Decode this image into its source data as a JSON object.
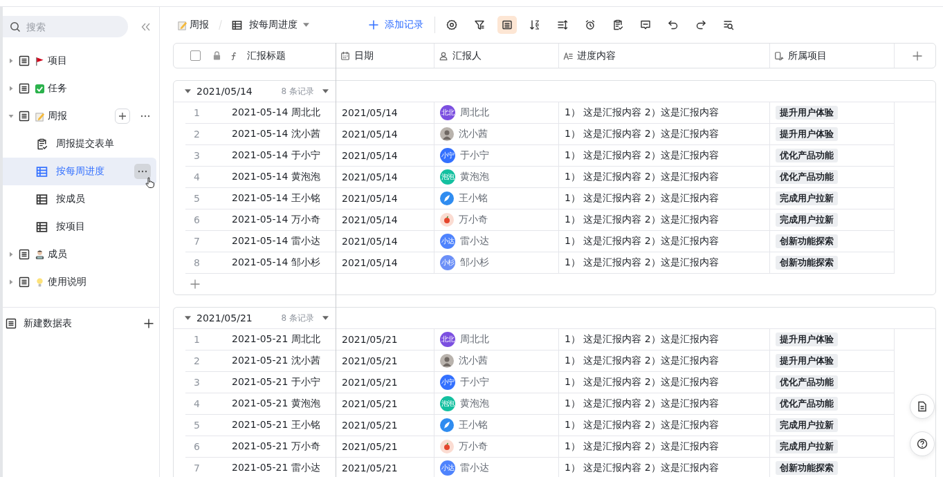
{
  "sidebar": {
    "search": {
      "placeholder": "搜索"
    },
    "items": [
      {
        "label": "项目",
        "expanded": false
      },
      {
        "label": "任务",
        "expanded": false
      },
      {
        "label": "周报",
        "expanded": true,
        "children": [
          {
            "label": "周报提交表单",
            "kind": "form",
            "selected": false
          },
          {
            "label": "按每周进度",
            "kind": "grid",
            "selected": true
          },
          {
            "label": "按成员",
            "kind": "grid",
            "selected": false
          },
          {
            "label": "按项目",
            "kind": "grid",
            "selected": false
          }
        ]
      },
      {
        "label": "成员",
        "expanded": false
      },
      {
        "label": "使用说明",
        "expanded": false
      }
    ],
    "new_table": "新建数据表"
  },
  "toolbar": {
    "breadcrumb": "周报",
    "view": "按每周进度",
    "add_record": "添加记录",
    "tools": [
      {
        "selected": false
      },
      {
        "selected": false
      },
      {
        "selected": true
      },
      {
        "selected": false
      },
      {
        "selected": false
      },
      {
        "selected": false
      },
      {
        "selected": false
      },
      {
        "selected": false
      },
      {
        "selected": false
      },
      {
        "selected": false
      },
      {
        "selected": false
      }
    ]
  },
  "table": {
    "select_all": {
      "checked": false
    },
    "columns": [
      "汇报标题",
      "日期",
      "汇报人",
      "进度内容",
      "所属项目"
    ],
    "groups": [
      {
        "title": "2021/05/14",
        "count": "8 条记录",
        "rows": [
          {
            "num": "1",
            "title": "2021-05-14 周北北",
            "date": "2021/05/14",
            "reporter": {
              "name": "周北北",
              "kind": "text",
              "avatar_text": "北北",
              "color": "#7b4fe0"
            },
            "content": "1） 这是汇报内容 2）这是汇报内容",
            "project": "提升用户体验"
          },
          {
            "num": "2",
            "title": "2021-05-14 沈小茜",
            "date": "2021/05/14",
            "reporter": {
              "name": "沈小茜",
              "kind": "photo",
              "color": "#b9b3ad"
            },
            "content": "1） 这是汇报内容 2）这是汇报内容",
            "project": "提升用户体验"
          },
          {
            "num": "3",
            "title": "2021-05-14 于小宁",
            "date": "2021/05/14",
            "reporter": {
              "name": "于小宁",
              "kind": "text",
              "avatar_text": "小宁",
              "color": "#3370ff"
            },
            "content": "1） 这是汇报内容 2）这是汇报内容",
            "project": "优化产品功能"
          },
          {
            "num": "4",
            "title": "2021-05-14 黄泡泡",
            "date": "2021/05/14",
            "reporter": {
              "name": "黄泡泡",
              "kind": "text",
              "avatar_text": "泡泡",
              "color": "#14c0a0"
            },
            "content": "1） 这是汇报内容 2）这是汇报内容",
            "project": "优化产品功能"
          },
          {
            "num": "5",
            "title": "2021-05-14 王小铭",
            "date": "2021/05/14",
            "reporter": {
              "name": "王小铭",
              "kind": "feather",
              "color": "#2f8cf0"
            },
            "content": "1） 这是汇报内容 2）这是汇报内容",
            "project": "完成用户拉新"
          },
          {
            "num": "6",
            "title": "2021-05-14 万小奇",
            "date": "2021/05/14",
            "reporter": {
              "name": "万小奇",
              "kind": "apple",
              "color": "#fbdcd2"
            },
            "content": "1） 这是汇报内容 2）这是汇报内容",
            "project": "完成用户拉新"
          },
          {
            "num": "7",
            "title": "2021-05-14 雷小达",
            "date": "2021/05/14",
            "reporter": {
              "name": "雷小达",
              "kind": "text",
              "avatar_text": "小达",
              "color": "#4e83fd"
            },
            "content": "1） 这是汇报内容 2）这是汇报内容",
            "project": "创新功能探索"
          },
          {
            "num": "8",
            "title": "2021-05-14 邹小杉",
            "date": "2021/05/14",
            "reporter": {
              "name": "邹小杉",
              "kind": "text",
              "avatar_text": "小杉",
              "color": "#6b8ff7"
            },
            "content": "1） 这是汇报内容 2）这是汇报内容",
            "project": "创新功能探索"
          }
        ]
      },
      {
        "title": "2021/05/21",
        "count": "8 条记录",
        "rows": [
          {
            "num": "1",
            "title": "2021-05-21 周北北",
            "date": "2021/05/21",
            "reporter": {
              "name": "周北北",
              "kind": "text",
              "avatar_text": "北北",
              "color": "#7b4fe0"
            },
            "content": "1） 这是汇报内容 2）这是汇报内容",
            "project": "提升用户体验"
          },
          {
            "num": "2",
            "title": "2021-05-21 沈小茜",
            "date": "2021/05/21",
            "reporter": {
              "name": "沈小茜",
              "kind": "photo",
              "color": "#b9b3ad"
            },
            "content": "1） 这是汇报内容 2）这是汇报内容",
            "project": "提升用户体验"
          },
          {
            "num": "3",
            "title": "2021-05-21 于小宁",
            "date": "2021/05/21",
            "reporter": {
              "name": "于小宁",
              "kind": "text",
              "avatar_text": "小宁",
              "color": "#3370ff"
            },
            "content": "1） 这是汇报内容 2）这是汇报内容",
            "project": "优化产品功能"
          },
          {
            "num": "4",
            "title": "2021-05-21 黄泡泡",
            "date": "2021/05/21",
            "reporter": {
              "name": "黄泡泡",
              "kind": "text",
              "avatar_text": "泡泡",
              "color": "#14c0a0"
            },
            "content": "1） 这是汇报内容 2）这是汇报内容",
            "project": "优化产品功能"
          },
          {
            "num": "5",
            "title": "2021-05-21 王小铭",
            "date": "2021/05/21",
            "reporter": {
              "name": "王小铭",
              "kind": "feather",
              "color": "#2f8cf0"
            },
            "content": "1） 这是汇报内容 2）这是汇报内容",
            "project": "完成用户拉新"
          },
          {
            "num": "6",
            "title": "2021-05-21 万小奇",
            "date": "2021/05/21",
            "reporter": {
              "name": "万小奇",
              "kind": "apple",
              "color": "#fbdcd2"
            },
            "content": "1） 这是汇报内容 2）这是汇报内容",
            "project": "完成用户拉新"
          },
          {
            "num": "7",
            "title": "2021-05-21 雷小达",
            "date": "2021/05/21",
            "reporter": {
              "name": "雷小达",
              "kind": "text",
              "avatar_text": "小达",
              "color": "#4e83fd"
            },
            "content": "1） 这是汇报内容 2）这是汇报内容",
            "project": "创新功能探索"
          }
        ]
      }
    ]
  }
}
